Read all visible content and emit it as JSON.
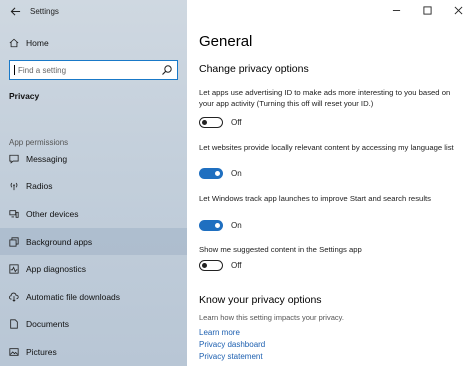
{
  "window": {
    "title": "Settings",
    "controls": {
      "minimize": "minimize-icon",
      "maximize": "maximize-icon",
      "close": "close-icon"
    }
  },
  "sidebar": {
    "home_label": "Home",
    "search_placeholder": "Find a setting",
    "category_heading": "Privacy",
    "section_heading": "App permissions",
    "items": [
      {
        "label": "Messaging",
        "icon": "messaging-icon"
      },
      {
        "label": "Radios",
        "icon": "radios-icon"
      },
      {
        "label": "Other devices",
        "icon": "other-devices-icon"
      },
      {
        "label": "Background apps",
        "icon": "background-apps-icon",
        "selected": true
      },
      {
        "label": "App diagnostics",
        "icon": "app-diagnostics-icon"
      },
      {
        "label": "Automatic file downloads",
        "icon": "cloud-download-icon"
      },
      {
        "label": "Documents",
        "icon": "documents-icon"
      },
      {
        "label": "Pictures",
        "icon": "pictures-icon"
      }
    ]
  },
  "main": {
    "title": "General",
    "subheading": "Change privacy options",
    "settings": [
      {
        "text": "Let apps use advertising ID to make ads more interesting to you based on your app activity (Turning this off will reset your ID.)",
        "state": "Off"
      },
      {
        "text": "Let websites provide locally relevant content by accessing my language list",
        "state": "On"
      },
      {
        "text": "Let Windows track app launches to improve Start and search results",
        "state": "On"
      },
      {
        "text": "Show me suggested content in the Settings app",
        "state": "Off"
      }
    ],
    "know": {
      "heading": "Know your privacy options",
      "description": "Learn how this setting impacts your privacy.",
      "links": [
        "Learn more",
        "Privacy dashboard",
        "Privacy statement"
      ]
    }
  },
  "colors": {
    "accent": "#1f6fc0",
    "link": "#1c5fb0",
    "sidebar": "#c3cfdb"
  }
}
